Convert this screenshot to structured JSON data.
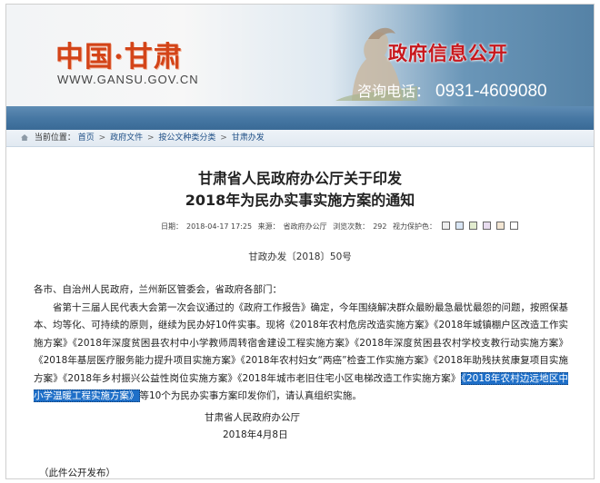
{
  "header": {
    "logo_text": "中国·甘肃",
    "logo_url": "WWW.GANSU.GOV.CN",
    "title": "政府信息公开",
    "hotline_label": "咨询电话：",
    "hotline_number": "0931-4609080"
  },
  "breadcrumb": {
    "label": "当前位置：",
    "items": [
      "首页",
      "政府文件",
      "按公文种类分类",
      "甘肃办发"
    ],
    "separator": ">"
  },
  "article": {
    "title_line1": "甘肃省人民政府办公厅关于印发",
    "title_line2": "2018年为民办实事实施方案的通知",
    "meta": {
      "date_label": "日期：",
      "date_value": "2018-04-17 17:25",
      "source_label": "来源：",
      "source_value": "省政府办公厅",
      "views_label": "浏览次数：",
      "views_value": "292",
      "scheme_label": "视力保护色："
    },
    "doc_number": "甘政办发〔2018〕50号",
    "salutation": "各市、自治州人民政府，兰州新区管委会，省政府各部门：",
    "body_pre": "省第十三届人民代表大会第一次会议通过的《政府工作报告》确定，今年围绕解决群众最盼最急最忧最怨的问题，按照保基本、均等化、可持续的原则，继续为民办好10件实事。现将《2018年农村危房改造实施方案》《2018年城镇棚户区改造工作实施方案》《2018年深度贫困县农村中小学教师周转宿舍建设工程实施方案》《2018年深度贫困县农村学校支教行动实施方案》《2018年基层医疗服务能力提升项目实施方案》《2018年农村妇女“两癌”检查工作实施方案》《2018年助残扶贫康复项目实施方案》《2018年乡村振兴公益性岗位实施方案》《2018年城市老旧住宅小区电梯改造工作实施方案》",
    "body_highlight": "《2018年农村边远地区中小学温暖工程实施方案》",
    "body_post": "等10个为民办实事方案印发你们，请认真组织实施。",
    "signer": "甘肃省人民政府办公厅",
    "sign_date": "2018年4月8日",
    "release_note": "（此件公开发布）"
  },
  "colors": {
    "accent_red": "#c8171c",
    "logo_orange": "#d34418",
    "band_blue": "#4576a2",
    "highlight_blue": "#1e6fc8",
    "swatches": [
      "#eeeeee",
      "#d9e6f5",
      "#e2eccf",
      "#e8dcef",
      "#f3e6d3",
      "#ffffff"
    ]
  }
}
